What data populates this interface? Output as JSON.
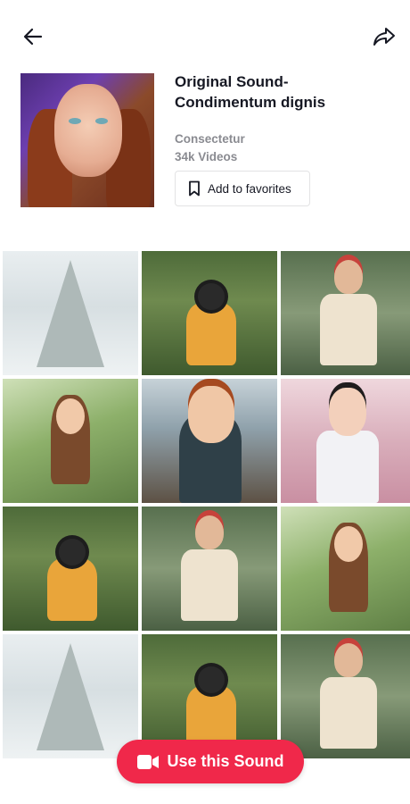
{
  "header": {
    "back_icon": "arrow-left-icon",
    "share_icon": "share-arrow-icon"
  },
  "sound": {
    "title_line1": "Original Sound-",
    "title_line2": "Condimentum dignis",
    "author": "Consectetur",
    "video_count": "34k Videos",
    "favorite_label": "Add to favorites",
    "favorite_icon": "bookmark-icon"
  },
  "grid": {
    "tiles": [
      {
        "scene": "snowy-tree"
      },
      {
        "scene": "girl-with-camera"
      },
      {
        "scene": "girl-with-red-cap"
      },
      {
        "scene": "girl-with-ukulele"
      },
      {
        "scene": "girl-with-glasses-and-cup"
      },
      {
        "scene": "girl-on-pink-couch"
      },
      {
        "scene": "girl-with-camera"
      },
      {
        "scene": "girl-with-red-cap"
      },
      {
        "scene": "girl-with-ukulele"
      },
      {
        "scene": "snowy-tree"
      },
      {
        "scene": "girl-with-camera"
      },
      {
        "scene": "girl-with-red-cap"
      }
    ]
  },
  "cta": {
    "label": "Use this Sound",
    "icon": "video-camera-icon"
  },
  "colors": {
    "accent": "#f0284a",
    "text": "#161823",
    "muted": "#8a8b91"
  }
}
